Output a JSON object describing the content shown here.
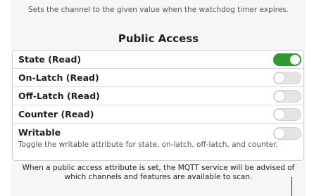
{
  "top_hint": "Sets the channel to the given value when the watchdog timer expires.",
  "section_title": "Public Access",
  "rows": [
    {
      "label": "State (Read)",
      "on": true
    },
    {
      "label": "On-Latch (Read)",
      "on": false
    },
    {
      "label": "Off-Latch (Read)",
      "on": false
    },
    {
      "label": "Counter (Read)",
      "on": false
    },
    {
      "label": "Writable",
      "on": false,
      "description": "Toggle the writable attribute for state, on-latch, off-latch, and counter."
    }
  ],
  "footer_line1": "When a public access attribute is set, the MQTT service will be advised of",
  "footer_line2": "which channels and features are available to scan.",
  "colors": {
    "toggle_on": "#2f9a2f",
    "toggle_off": "#e4e4e4"
  }
}
